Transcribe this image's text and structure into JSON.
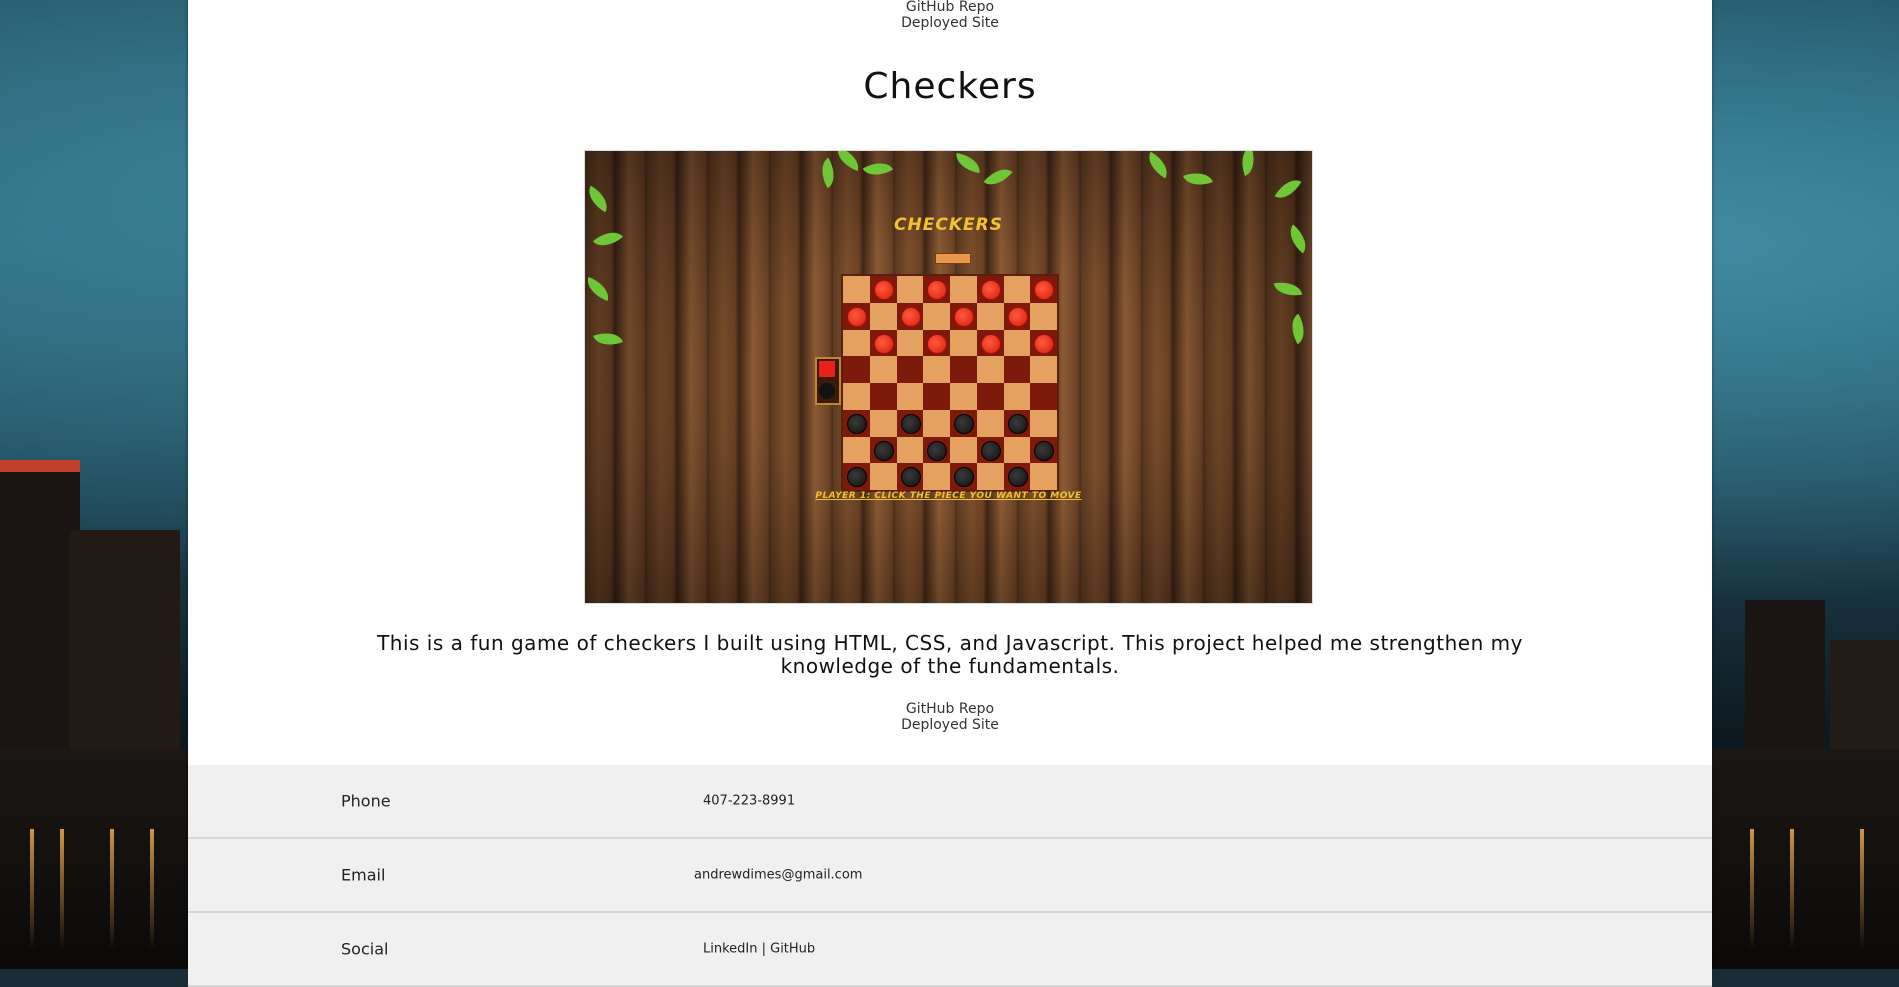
{
  "top_links": {
    "repo": "GitHub Repo",
    "site": "Deployed Site"
  },
  "project": {
    "title": "Checkers",
    "game_title": "CHECKERS",
    "game_message": "PLAYER 1: CLICK THE PIECE YOU WANT TO MOVE",
    "description": "This is a fun game of checkers I built using HTML, CSS, and Javascript. This project helped me strengthen my knowledge of the fundamentals.",
    "repo_link": "GitHub Repo",
    "site_link": "Deployed Site"
  },
  "contact": [
    {
      "label": "Phone",
      "value": "407-223-8991"
    },
    {
      "label": "Email",
      "value": "andrewdimes@gmail.com"
    },
    {
      "label": "Social",
      "value": "LinkedIn | GitHub"
    }
  ],
  "board": {
    "rows": [
      ".r.r.r.r",
      "r.r.r.r.",
      ".r.r.r.r",
      "........",
      "........",
      "b.b.b.b.",
      ".b.b.b.b",
      "b.b.b.b."
    ]
  }
}
